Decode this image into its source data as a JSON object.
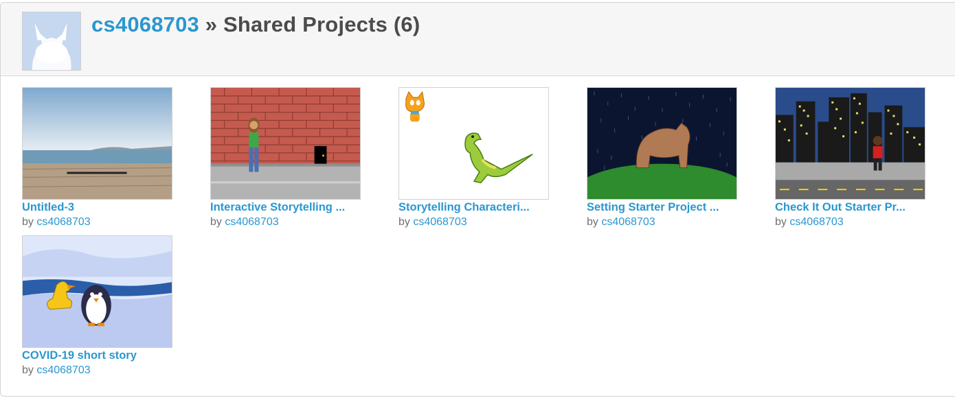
{
  "header": {
    "username": "cs4068703",
    "title_suffix": " » Shared Projects (6)"
  },
  "projects": [
    {
      "title": "Untitled-3",
      "by": "by ",
      "owner": "cs4068703"
    },
    {
      "title": "Interactive Storytelling ...",
      "by": "by ",
      "owner": "cs4068703"
    },
    {
      "title": "Storytelling Characteri...",
      "by": "by ",
      "owner": "cs4068703"
    },
    {
      "title": "Setting Starter Project ...",
      "by": "by ",
      "owner": "cs4068703"
    },
    {
      "title": "Check It Out Starter Pr...",
      "by": "by ",
      "owner": "cs4068703"
    },
    {
      "title": "COVID-19 short story",
      "by": "by ",
      "owner": "cs4068703"
    }
  ],
  "colors": {
    "link": "#2a97cf",
    "heading": "#4b4b4b",
    "header_bg": "#f6f6f6"
  }
}
